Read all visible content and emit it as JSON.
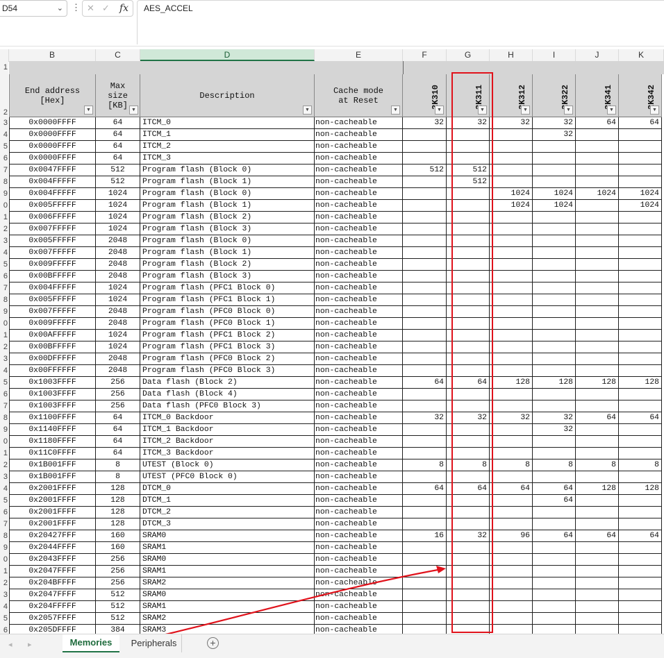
{
  "formula_bar": {
    "name_box": "D54",
    "fx_label": "fx",
    "cancel_glyph": "✕",
    "confirm_glyph": "✓",
    "formula_value": "AES_ACCEL"
  },
  "column_headers": [
    "B",
    "C",
    "D",
    "E",
    "F",
    "G",
    "H",
    "I",
    "J",
    "K"
  ],
  "selected_column": "D",
  "row_numbers": [
    "1",
    "2",
    "3",
    "4",
    "5",
    "6",
    "7",
    "8",
    "9",
    "0",
    "1",
    "2",
    "3",
    "4",
    "5",
    "6",
    "7",
    "8",
    "9",
    "0",
    "1",
    "2",
    "3",
    "4",
    "5",
    "6",
    "7",
    "8",
    "9",
    "0",
    "1",
    "2",
    "3",
    "4",
    "5",
    "6",
    "7",
    "8",
    "9",
    "0",
    "1",
    "2",
    "3",
    "4",
    "5",
    "6"
  ],
  "table_headers": {
    "end_address": "End address\n[Hex]",
    "max_size": "Max\nsize\n[KB]",
    "description": "Description",
    "cache_mode": "Cache mode\nat Reset",
    "variants": [
      "2K310",
      "2K311",
      "2K312",
      "2K322",
      "2K341",
      "2K342"
    ]
  },
  "rows": [
    {
      "addr": "0x0000FFFF",
      "size": "64",
      "desc": "ITCM_0",
      "cache": "non-cacheable",
      "v": [
        "32",
        "32",
        "32",
        "32",
        "64",
        "64"
      ]
    },
    {
      "addr": "0x0000FFFF",
      "size": "64",
      "desc": "ITCM_1",
      "cache": "non-cacheable",
      "v": [
        "",
        "",
        "",
        "32",
        "",
        ""
      ]
    },
    {
      "addr": "0x0000FFFF",
      "size": "64",
      "desc": "ITCM_2",
      "cache": "non-cacheable",
      "v": [
        "",
        "",
        "",
        "",
        "",
        ""
      ]
    },
    {
      "addr": "0x0000FFFF",
      "size": "64",
      "desc": "ITCM_3",
      "cache": "non-cacheable",
      "v": [
        "",
        "",
        "",
        "",
        "",
        ""
      ]
    },
    {
      "addr": "0x0047FFFF",
      "size": "512",
      "desc": "Program flash (Block 0)",
      "cache": "non-cacheable",
      "v": [
        "512",
        "512",
        "",
        "",
        "",
        ""
      ]
    },
    {
      "addr": "0x004FFFFF",
      "size": "512",
      "desc": "Program flash (Block 1)",
      "cache": "non-cacheable",
      "v": [
        "",
        "512",
        "",
        "",
        "",
        ""
      ]
    },
    {
      "addr": "0x004FFFFF",
      "size": "1024",
      "desc": "Program flash (Block 0)",
      "cache": "non-cacheable",
      "v": [
        "",
        "",
        "1024",
        "1024",
        "1024",
        "1024"
      ]
    },
    {
      "addr": "0x005FFFFF",
      "size": "1024",
      "desc": "Program flash (Block 1)",
      "cache": "non-cacheable",
      "v": [
        "",
        "",
        "1024",
        "1024",
        "",
        "1024"
      ]
    },
    {
      "addr": "0x006FFFFF",
      "size": "1024",
      "desc": "Program flash (Block 2)",
      "cache": "non-cacheable",
      "v": [
        "",
        "",
        "",
        "",
        "",
        ""
      ]
    },
    {
      "addr": "0x007FFFFF",
      "size": "1024",
      "desc": "Program flash (Block 3)",
      "cache": "non-cacheable",
      "v": [
        "",
        "",
        "",
        "",
        "",
        ""
      ]
    },
    {
      "addr": "0x005FFFFF",
      "size": "2048",
      "desc": "Program flash (Block 0)",
      "cache": "non-cacheable",
      "v": [
        "",
        "",
        "",
        "",
        "",
        ""
      ]
    },
    {
      "addr": "0x007FFFFF",
      "size": "2048",
      "desc": "Program flash (Block 1)",
      "cache": "non-cacheable",
      "v": [
        "",
        "",
        "",
        "",
        "",
        ""
      ]
    },
    {
      "addr": "0x009FFFFF",
      "size": "2048",
      "desc": "Program flash (Block 2)",
      "cache": "non-cacheable",
      "v": [
        "",
        "",
        "",
        "",
        "",
        ""
      ]
    },
    {
      "addr": "0x00BFFFFF",
      "size": "2048",
      "desc": "Program flash (Block 3)",
      "cache": "non-cacheable",
      "v": [
        "",
        "",
        "",
        "",
        "",
        ""
      ]
    },
    {
      "addr": "0x004FFFFF",
      "size": "1024",
      "desc": "Program flash (PFC1 Block 0)",
      "cache": "non-cacheable",
      "v": [
        "",
        "",
        "",
        "",
        "",
        ""
      ]
    },
    {
      "addr": "0x005FFFFF",
      "size": "1024",
      "desc": "Program flash (PFC1 Block 1)",
      "cache": "non-cacheable",
      "v": [
        "",
        "",
        "",
        "",
        "",
        ""
      ]
    },
    {
      "addr": "0x007FFFFF",
      "size": "2048",
      "desc": "Program flash (PFC0 Block 0)",
      "cache": "non-cacheable",
      "v": [
        "",
        "",
        "",
        "",
        "",
        ""
      ]
    },
    {
      "addr": "0x009FFFFF",
      "size": "2048",
      "desc": "Program flash (PFC0 Block 1)",
      "cache": "non-cacheable",
      "v": [
        "",
        "",
        "",
        "",
        "",
        ""
      ]
    },
    {
      "addr": "0x00AFFFFF",
      "size": "1024",
      "desc": "Program flash (PFC1 Block 2)",
      "cache": "non-cacheable",
      "v": [
        "",
        "",
        "",
        "",
        "",
        ""
      ]
    },
    {
      "addr": "0x00BFFFFF",
      "size": "1024",
      "desc": "Program flash (PFC1 Block 3)",
      "cache": "non-cacheable",
      "v": [
        "",
        "",
        "",
        "",
        "",
        ""
      ]
    },
    {
      "addr": "0x00DFFFFF",
      "size": "2048",
      "desc": "Program flash (PFC0 Block 2)",
      "cache": "non-cacheable",
      "v": [
        "",
        "",
        "",
        "",
        "",
        ""
      ]
    },
    {
      "addr": "0x00FFFFFF",
      "size": "2048",
      "desc": "Program flash (PFC0 Block 3)",
      "cache": "non-cacheable",
      "v": [
        "",
        "",
        "",
        "",
        "",
        ""
      ]
    },
    {
      "addr": "0x1003FFFF",
      "size": "256",
      "desc": "Data flash (Block 2)",
      "cache": "non-cacheable",
      "v": [
        "64",
        "64",
        "128",
        "128",
        "128",
        "128"
      ]
    },
    {
      "addr": "0x1003FFFF",
      "size": "256",
      "desc": "Data flash (Block 4)",
      "cache": "non-cacheable",
      "v": [
        "",
        "",
        "",
        "",
        "",
        ""
      ]
    },
    {
      "addr": "0x1003FFFF",
      "size": "256",
      "desc": "Data flash (PFC0 Block 3)",
      "cache": "non-cacheable",
      "v": [
        "",
        "",
        "",
        "",
        "",
        ""
      ]
    },
    {
      "addr": "0x1100FFFF",
      "size": "64",
      "desc": "ITCM_0 Backdoor",
      "cache": "non-cacheable",
      "v": [
        "32",
        "32",
        "32",
        "32",
        "64",
        "64"
      ]
    },
    {
      "addr": "0x1140FFFF",
      "size": "64",
      "desc": "ITCM_1 Backdoor",
      "cache": "non-cacheable",
      "v": [
        "",
        "",
        "",
        "32",
        "",
        ""
      ]
    },
    {
      "addr": "0x1180FFFF",
      "size": "64",
      "desc": "ITCM_2 Backdoor",
      "cache": "non-cacheable",
      "v": [
        "",
        "",
        "",
        "",
        "",
        ""
      ]
    },
    {
      "addr": "0x11C0FFFF",
      "size": "64",
      "desc": "ITCM_3 Backdoor",
      "cache": "non-cacheable",
      "v": [
        "",
        "",
        "",
        "",
        "",
        ""
      ]
    },
    {
      "addr": "0x1B001FFF",
      "size": "8",
      "desc": "UTEST (Block 0)",
      "cache": "non-cacheable",
      "v": [
        "8",
        "8",
        "8",
        "8",
        "8",
        "8"
      ]
    },
    {
      "addr": "0x1B001FFF",
      "size": "8",
      "desc": "UTEST (PFC0 Block 0)",
      "cache": "non-cacheable",
      "v": [
        "",
        "",
        "",
        "",
        "",
        ""
      ]
    },
    {
      "addr": "0x2001FFFF",
      "size": "128",
      "desc": "DTCM_0",
      "cache": "non-cacheable",
      "v": [
        "64",
        "64",
        "64",
        "64",
        "128",
        "128"
      ]
    },
    {
      "addr": "0x2001FFFF",
      "size": "128",
      "desc": "DTCM_1",
      "cache": "non-cacheable",
      "v": [
        "",
        "",
        "",
        "64",
        "",
        ""
      ]
    },
    {
      "addr": "0x2001FFFF",
      "size": "128",
      "desc": "DTCM_2",
      "cache": "non-cacheable",
      "v": [
        "",
        "",
        "",
        "",
        "",
        ""
      ]
    },
    {
      "addr": "0x2001FFFF",
      "size": "128",
      "desc": "DTCM_3",
      "cache": "non-cacheable",
      "v": [
        "",
        "",
        "",
        "",
        "",
        ""
      ]
    },
    {
      "addr": "0x20427FFF",
      "size": "160",
      "desc": "SRAM0",
      "cache": "non-cacheable",
      "v": [
        "16",
        "32",
        "96",
        "64",
        "64",
        "64"
      ]
    },
    {
      "addr": "0x2044FFFF",
      "size": "160",
      "desc": "SRAM1",
      "cache": "non-cacheable",
      "v": [
        "",
        "",
        "",
        "",
        "",
        ""
      ]
    },
    {
      "addr": "0x2043FFFF",
      "size": "256",
      "desc": "SRAM0",
      "cache": "non-cacheable",
      "v": [
        "",
        "",
        "",
        "",
        "",
        ""
      ]
    },
    {
      "addr": "0x2047FFFF",
      "size": "256",
      "desc": "SRAM1",
      "cache": "non-cacheable",
      "v": [
        "",
        "",
        "",
        "",
        "",
        ""
      ]
    },
    {
      "addr": "0x204BFFFF",
      "size": "256",
      "desc": "SRAM2",
      "cache": "non-cacheable",
      "v": [
        "",
        "",
        "",
        "",
        "",
        ""
      ]
    },
    {
      "addr": "0x2047FFFF",
      "size": "512",
      "desc": "SRAM0",
      "cache": "non-cacheable",
      "v": [
        "",
        "",
        "",
        "",
        "",
        ""
      ]
    },
    {
      "addr": "0x204FFFFF",
      "size": "512",
      "desc": "SRAM1",
      "cache": "non-cacheable",
      "v": [
        "",
        "",
        "",
        "",
        "",
        ""
      ]
    },
    {
      "addr": "0x2057FFFF",
      "size": "512",
      "desc": "SRAM2",
      "cache": "non-cacheable",
      "v": [
        "",
        "",
        "",
        "",
        "",
        ""
      ]
    },
    {
      "addr": "0x205DFFFF",
      "size": "384",
      "desc": "SRAM3",
      "cache": "non-cacheable",
      "v": [
        "",
        "",
        "",
        "",
        "",
        ""
      ]
    }
  ],
  "sheet_tabs": {
    "active": "Memories",
    "other": "Peripherals",
    "add_glyph": "+"
  },
  "colors": {
    "accent": "#217346",
    "annotation": "#e0121b",
    "header_fill": "#d5d5d5"
  }
}
